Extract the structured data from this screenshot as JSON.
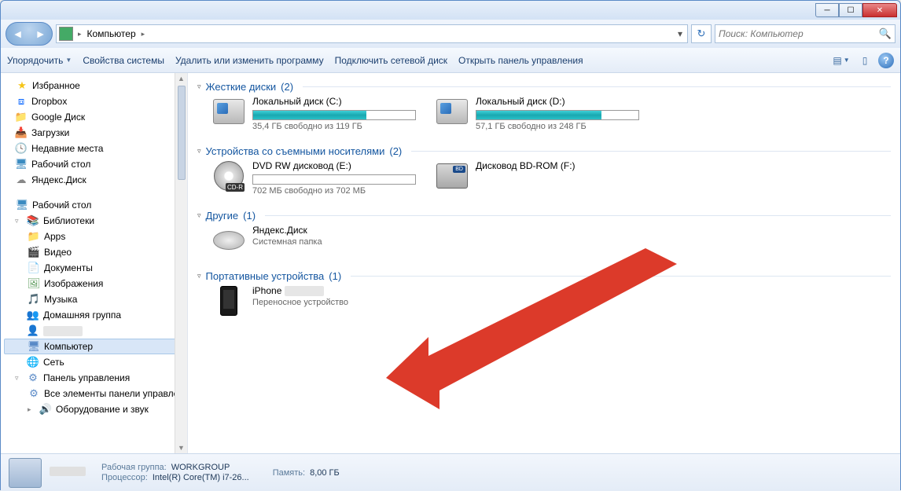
{
  "breadcrumb": {
    "root": "Компьютер",
    "sep": "▸"
  },
  "search": {
    "placeholder": "Поиск: Компьютер"
  },
  "toolbar": {
    "organize": "Упорядочить",
    "sysprops": "Свойства системы",
    "uninstall": "Удалить или изменить программу",
    "mapdrive": "Подключить сетевой диск",
    "controlpanel": "Открыть панель управления"
  },
  "sidebar": {
    "favorites": "Избранное",
    "fav_items": [
      {
        "label": "Dropbox"
      },
      {
        "label": "Google Диск"
      },
      {
        "label": "Загрузки"
      },
      {
        "label": "Недавние места"
      },
      {
        "label": "Рабочий стол"
      },
      {
        "label": "Яндекс.Диск"
      }
    ],
    "desktop": "Рабочий стол",
    "libraries": "Библиотеки",
    "lib_items": [
      {
        "label": "Apps"
      },
      {
        "label": "Видео"
      },
      {
        "label": "Документы"
      },
      {
        "label": "Изображения"
      },
      {
        "label": "Музыка"
      }
    ],
    "homegroup": "Домашняя группа",
    "user_blur": "",
    "computer": "Компьютер",
    "network": "Сеть",
    "control_panel": "Панель управления",
    "all_cp": "Все элементы панели управле",
    "hw_sound": "Оборудование и звук"
  },
  "groups": {
    "hdd": {
      "title": "Жесткие диски",
      "count": "(2)"
    },
    "removable": {
      "title": "Устройства со съемными носителями",
      "count": "(2)"
    },
    "other": {
      "title": "Другие",
      "count": "(1)"
    },
    "portable": {
      "title": "Портативные устройства",
      "count": "(1)"
    }
  },
  "drives": {
    "c": {
      "name": "Локальный диск (C:)",
      "sub": "35,4 ГБ свободно из 119 ГБ",
      "pct": 70
    },
    "d": {
      "name": "Локальный диск (D:)",
      "sub": "57,1 ГБ свободно из 248 ГБ",
      "pct": 77
    },
    "e": {
      "name": "DVD RW дисковод (E:)",
      "sub": "702 МБ свободно из 702 МБ",
      "pct": 0,
      "badge": "CD-R"
    },
    "f": {
      "name": "Дисковод BD-ROM (F:)",
      "badge": "BD"
    },
    "yandex": {
      "name": "Яндекс.Диск",
      "sub": "Системная папка"
    },
    "iphone": {
      "name": "iPhone",
      "sub": "Переносное устройство"
    }
  },
  "status": {
    "name_blur": "",
    "workgroup_label": "Рабочая группа:",
    "workgroup": "WORKGROUP",
    "cpu_label": "Процессор:",
    "cpu": "Intel(R) Core(TM) i7-26...",
    "memory_label": "Память:",
    "memory": "8,00 ГБ"
  }
}
